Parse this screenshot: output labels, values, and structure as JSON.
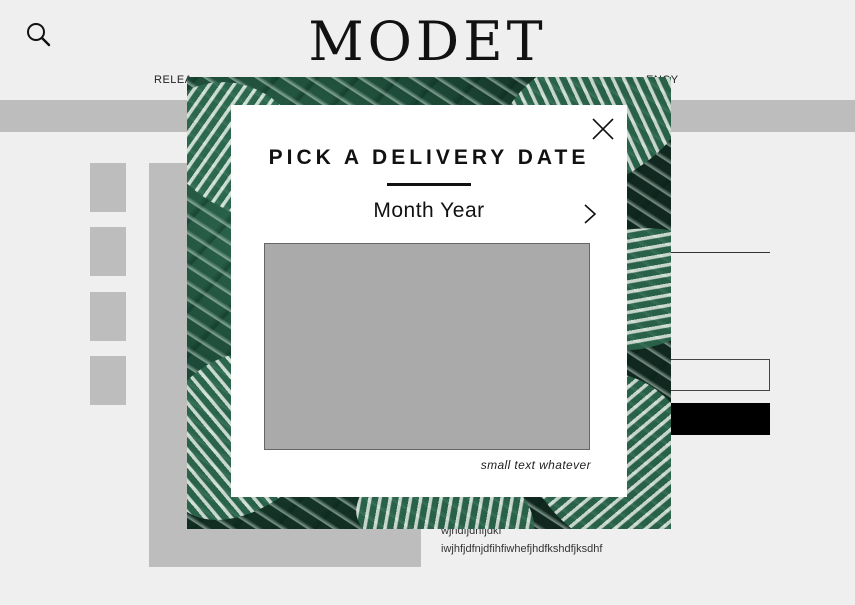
{
  "header": {
    "logo": "MODET",
    "search_icon": "search-icon",
    "nav_left_partial": "RELEA",
    "nav_right_partial": "ENCY"
  },
  "product": {
    "description_line1": "wjhdfjdhfjdkf",
    "description_line2": "iwjhfjdfnjdfihfiwhefjhdfkshdfjksdhf"
  },
  "modal": {
    "title": "PICK A DELIVERY DATE",
    "month_year": "Month Year",
    "small_text": "small text whatever",
    "close_icon": "close-icon",
    "next_icon": "chevron-right-icon"
  },
  "colors": {
    "page_bg": "#efefef",
    "placeholder_gray": "#bdbdbd",
    "calendar_gray": "#aaaaaa",
    "modal_bg": "#ffffff",
    "leaf_green": "#1d4a38"
  }
}
